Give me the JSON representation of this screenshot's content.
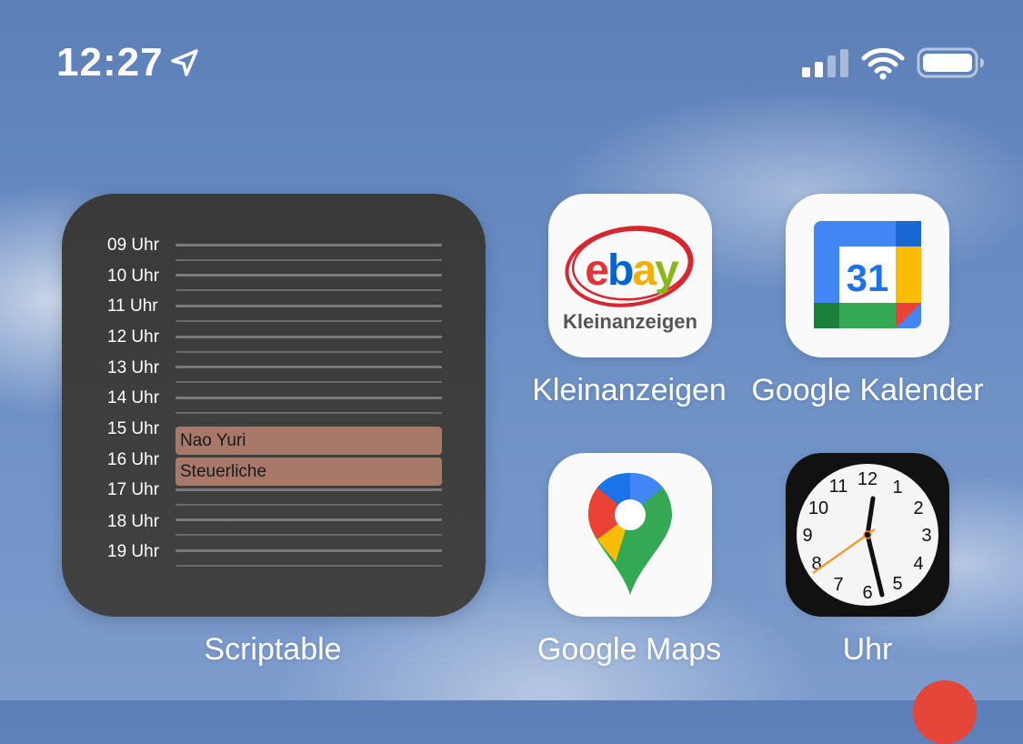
{
  "status_bar": {
    "time": "12:27",
    "location_icon": "location-arrow-icon",
    "signal_icon": "cellular-signal-icon",
    "wifi_icon": "wifi-icon",
    "battery_icon": "battery-icon"
  },
  "widget": {
    "app_name": "Scriptable",
    "hours": [
      "09 Uhr",
      "10 Uhr",
      "11 Uhr",
      "12 Uhr",
      "13 Uhr",
      "14 Uhr",
      "15 Uhr",
      "16 Uhr",
      "17 Uhr",
      "18 Uhr",
      "19 Uhr"
    ],
    "events": [
      {
        "title": "Nao Yuri"
      },
      {
        "title": "Steuerliche"
      }
    ]
  },
  "apps": {
    "kleinanzeigen": {
      "label": "Kleinanzeigen",
      "icon_text_brand": "ebay",
      "icon_text_sub": "Kleinanzeigen"
    },
    "google_kalender": {
      "label": "Google Kalender",
      "icon_text": "31"
    },
    "google_maps": {
      "label": "Google Maps"
    },
    "uhr": {
      "label": "Uhr",
      "dial": [
        "12",
        "1",
        "2",
        "3",
        "4",
        "5",
        "6",
        "7",
        "8",
        "9",
        "10",
        "11"
      ]
    }
  },
  "colors": {
    "event": "#a8796a",
    "widget_bg": "#3a3a3a",
    "clock_second_hand": "#f29a36",
    "dock_badge": "#e5463a"
  }
}
